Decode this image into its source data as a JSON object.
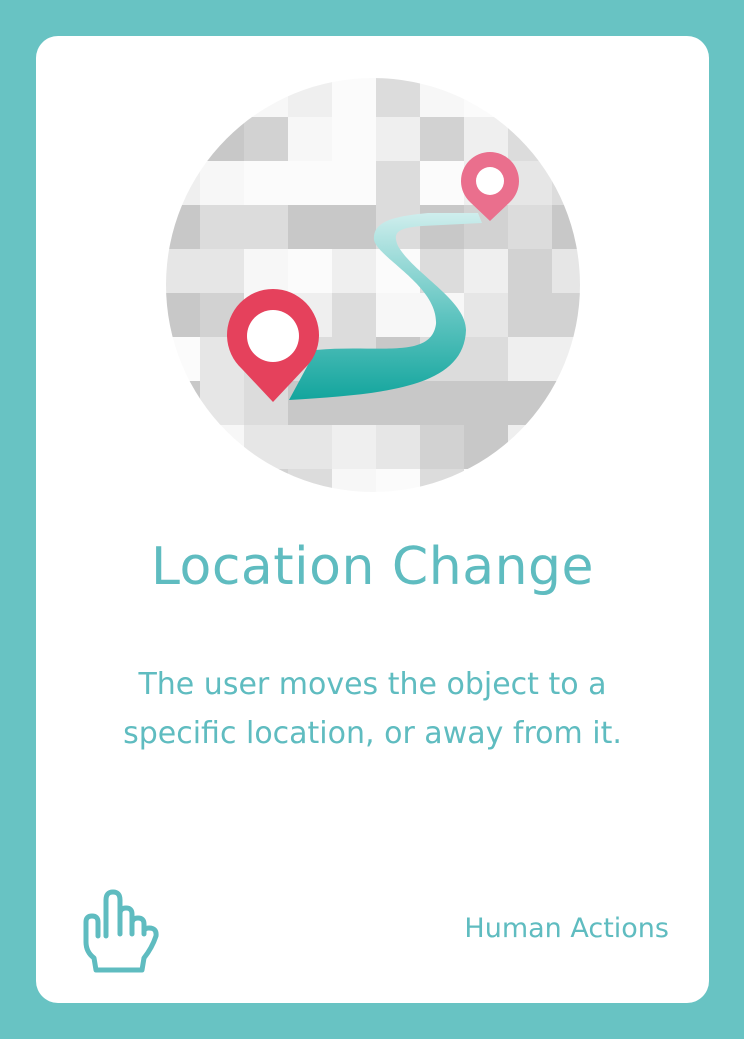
{
  "card": {
    "title": "Location Change",
    "description": "The user moves the object to a specific location, or away from it.",
    "category_label": "Human Actions",
    "category_icon": "hand-pointing-up-icon",
    "illustration_icon": "map-route-icon"
  },
  "colors": {
    "background": "#68c3c3",
    "card": "#ffffff",
    "text": "#5fbcc0",
    "pin": "#e5415c",
    "route": "#1aa9a2"
  }
}
